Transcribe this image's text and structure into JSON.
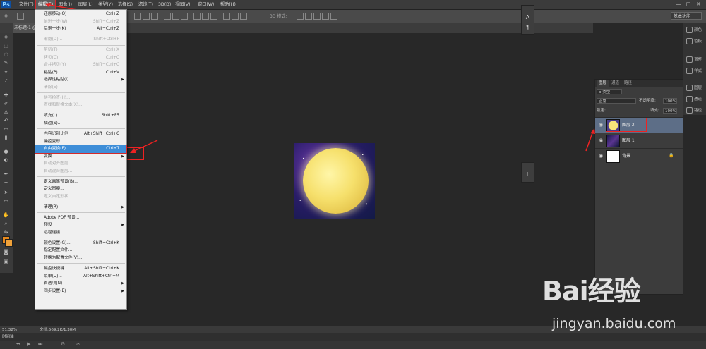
{
  "app": {
    "logo": "Ps"
  },
  "menubar": {
    "items": [
      "文件(F)",
      "编辑(E)",
      "图像(I)",
      "图层(L)",
      "类型(Y)",
      "选择(S)",
      "滤镜(T)",
      "3D(D)",
      "视图(V)",
      "窗口(W)",
      "帮助(H)"
    ],
    "active": "编辑(E)",
    "window_controls": [
      "—",
      "□",
      "✕"
    ]
  },
  "options_bar": {
    "mode_label": "3D 模式：",
    "workspace": "基本功能"
  },
  "doc_tab": {
    "label": "未标题-1 @ 51"
  },
  "edit_menu": [
    {
      "label": "还原移动(O)",
      "shortcut": "Ctrl+Z",
      "disabled": false
    },
    {
      "label": "前进一步(W)",
      "shortcut": "Shift+Ctrl+Z",
      "disabled": true
    },
    {
      "label": "后退一步(K)",
      "shortcut": "Alt+Ctrl+Z",
      "disabled": false
    },
    {
      "sep": true
    },
    {
      "label": "渐隐(D)...",
      "shortcut": "Shift+Ctrl+F",
      "disabled": true
    },
    {
      "sep": true
    },
    {
      "label": "剪切(T)",
      "shortcut": "Ctrl+X",
      "disabled": true
    },
    {
      "label": "拷贝(C)",
      "shortcut": "Ctrl+C",
      "disabled": true
    },
    {
      "label": "合并拷贝(Y)",
      "shortcut": "Shift+Ctrl+C",
      "disabled": true
    },
    {
      "label": "粘贴(P)",
      "shortcut": "Ctrl+V",
      "disabled": false
    },
    {
      "label": "选择性粘贴(I)",
      "shortcut": "",
      "disabled": false,
      "submenu": true
    },
    {
      "label": "清除(E)",
      "shortcut": "",
      "disabled": true
    },
    {
      "sep": true
    },
    {
      "label": "拼写检查(H)...",
      "shortcut": "",
      "disabled": true
    },
    {
      "label": "查找和替换文本(X)...",
      "shortcut": "",
      "disabled": true
    },
    {
      "sep": true
    },
    {
      "label": "填充(L)...",
      "shortcut": "Shift+F5",
      "disabled": false
    },
    {
      "label": "描边(S)...",
      "shortcut": "",
      "disabled": false
    },
    {
      "sep": true
    },
    {
      "label": "内容识别比例",
      "shortcut": "Alt+Shift+Ctrl+C",
      "disabled": false
    },
    {
      "label": "操控变形",
      "shortcut": "",
      "disabled": false
    },
    {
      "label": "自由变换(F)",
      "shortcut": "Ctrl+T",
      "disabled": false,
      "highlight": true
    },
    {
      "label": "变换",
      "shortcut": "",
      "disabled": false,
      "submenu": true
    },
    {
      "label": "自动对齐图层...",
      "shortcut": "",
      "disabled": true
    },
    {
      "label": "自动混合图层...",
      "shortcut": "",
      "disabled": true
    },
    {
      "sep": true
    },
    {
      "label": "定义画笔预设(B)...",
      "shortcut": "",
      "disabled": false
    },
    {
      "label": "定义图案...",
      "shortcut": "",
      "disabled": false
    },
    {
      "label": "定义自定形状...",
      "shortcut": "",
      "disabled": true
    },
    {
      "sep": true
    },
    {
      "label": "清理(R)",
      "shortcut": "",
      "disabled": false,
      "submenu": true
    },
    {
      "sep": true
    },
    {
      "label": "Adobe PDF 预设...",
      "shortcut": "",
      "disabled": false
    },
    {
      "label": "预设",
      "shortcut": "",
      "disabled": false,
      "submenu": true
    },
    {
      "label": "远程连接...",
      "shortcut": "",
      "disabled": false
    },
    {
      "sep": true
    },
    {
      "label": "颜色设置(G)...",
      "shortcut": "Shift+Ctrl+K",
      "disabled": false
    },
    {
      "label": "指定配置文件...",
      "shortcut": "",
      "disabled": false
    },
    {
      "label": "转换为配置文件(V)...",
      "shortcut": "",
      "disabled": false
    },
    {
      "sep": true
    },
    {
      "label": "键盘快捷键...",
      "shortcut": "Alt+Shift+Ctrl+K",
      "disabled": false
    },
    {
      "label": "菜单(U)...",
      "shortcut": "Alt+Shift+Ctrl+M",
      "disabled": false
    },
    {
      "label": "首选项(N)",
      "shortcut": "",
      "disabled": false,
      "submenu": true
    },
    {
      "label": "同步设置(E)",
      "shortcut": "",
      "disabled": false,
      "submenu": true
    }
  ],
  "layers_panel": {
    "tabs": [
      "图层",
      "通道",
      "路径"
    ],
    "filter_label": "ρ 类型",
    "blend_mode": "正常",
    "opacity_label": "不透明度:",
    "opacity_value": "100%",
    "lock_label": "锁定:",
    "fill_label": "填充:",
    "fill_value": "100%",
    "layers": [
      {
        "name": "图层 2",
        "selected": true,
        "thumb": "moon"
      },
      {
        "name": "图层 1",
        "selected": false,
        "thumb": "sky"
      },
      {
        "name": "背景",
        "selected": false,
        "thumb": "white",
        "locked": true
      }
    ]
  },
  "right_dock": [
    "颜色",
    "色板",
    "调整",
    "样式",
    "图层",
    "通道",
    "路径"
  ],
  "status": {
    "zoom": "51.32%",
    "doc_info": "文档:569.2K/1.30M"
  },
  "timeline": {
    "label": "时间轴"
  },
  "watermark": {
    "brand": "Bai经验",
    "url": "jingyan.baidu.com"
  },
  "colors": {
    "accent_highlight": "#3e8ed8",
    "annotation_red": "#e22222",
    "foreground": "#e8891c"
  }
}
